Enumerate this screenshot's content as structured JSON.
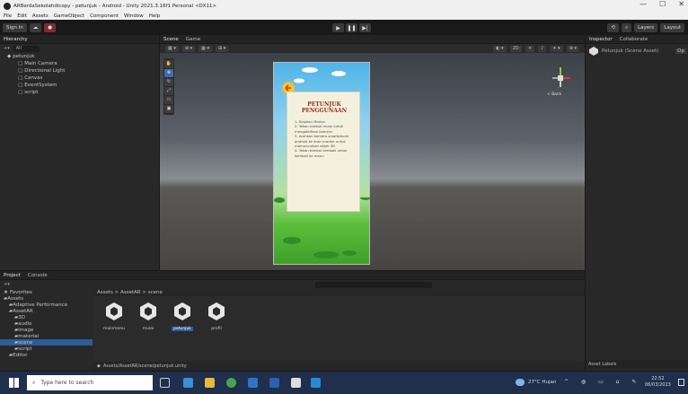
{
  "window": {
    "title": "ARBerdaSekolahdicopy - petunjuk - Android - Unity 2021.3.16f1 Personal <DX11>",
    "minimize": "—",
    "maximize": "☐",
    "close": "✕"
  },
  "menu": [
    "File",
    "Edit",
    "Assets",
    "GameObject",
    "Component",
    "Window",
    "Help"
  ],
  "toolbar": {
    "sign_in": "Sign in",
    "layers": "Layers",
    "layout": "Layout"
  },
  "hierarchy": {
    "tab": "Hierarchy",
    "search_placeholder": "All",
    "items": [
      {
        "label": "petunjuk",
        "level": 0
      },
      {
        "label": "Main Camera",
        "level": 1
      },
      {
        "label": "Directional Light",
        "level": 1
      },
      {
        "label": "Canvas",
        "level": 1
      },
      {
        "label": "EventSystem",
        "level": 1
      },
      {
        "label": "script",
        "level": 1
      }
    ]
  },
  "scene": {
    "tab_scene": "Scene",
    "tab_game": "Game",
    "gizmo_label": "< Back",
    "card_title": "PETUNJUK PENGGUNAAN",
    "card_lines": [
      "1. Siapkan Marker",
      "2. Tekan tombol mulai untuk mengaktifkan kamera",
      "3. Arahkan kamera smartphone android ke arah marker untuk memunculkan objek 3D",
      "4. Tekan tombol kembali untuk kembali ke menu"
    ]
  },
  "inspector": {
    "tab_inspector": "Inspector",
    "tab_collaborate": "Collaborate",
    "title": "Petunjuk (Scene Asset)",
    "open_btn": "Op",
    "asset_labels": "Asset Labels"
  },
  "project": {
    "tab_project": "Project",
    "tab_console": "Console",
    "favorites": "Favorites",
    "tree": [
      {
        "label": "Assets",
        "level": 0
      },
      {
        "label": "Adaptive Performance",
        "level": 1
      },
      {
        "label": "AssetAR",
        "level": 1
      },
      {
        "label": "3D",
        "level": 2
      },
      {
        "label": "audio",
        "level": 2
      },
      {
        "label": "image",
        "level": 2
      },
      {
        "label": "material",
        "level": 2
      },
      {
        "label": "scene",
        "level": 2
      },
      {
        "label": "script",
        "level": 2
      },
      {
        "label": "Editor",
        "level": 1
      }
    ],
    "breadcrumb": "Assets > AssetAR > scene",
    "assets": [
      "mainmenu",
      "mulai",
      "petunjuk",
      "profil"
    ],
    "selected_asset": "petunjuk",
    "path": "Assets/AssetAR/scene/petunjuk.unity"
  },
  "taskbar": {
    "search_placeholder": "Type here to search",
    "weather": "27°C Hujan",
    "time": "22:52",
    "date": "06/03/2023"
  },
  "colors": {
    "accent": "#2c5d97",
    "card_title": "#9b2a1e"
  }
}
